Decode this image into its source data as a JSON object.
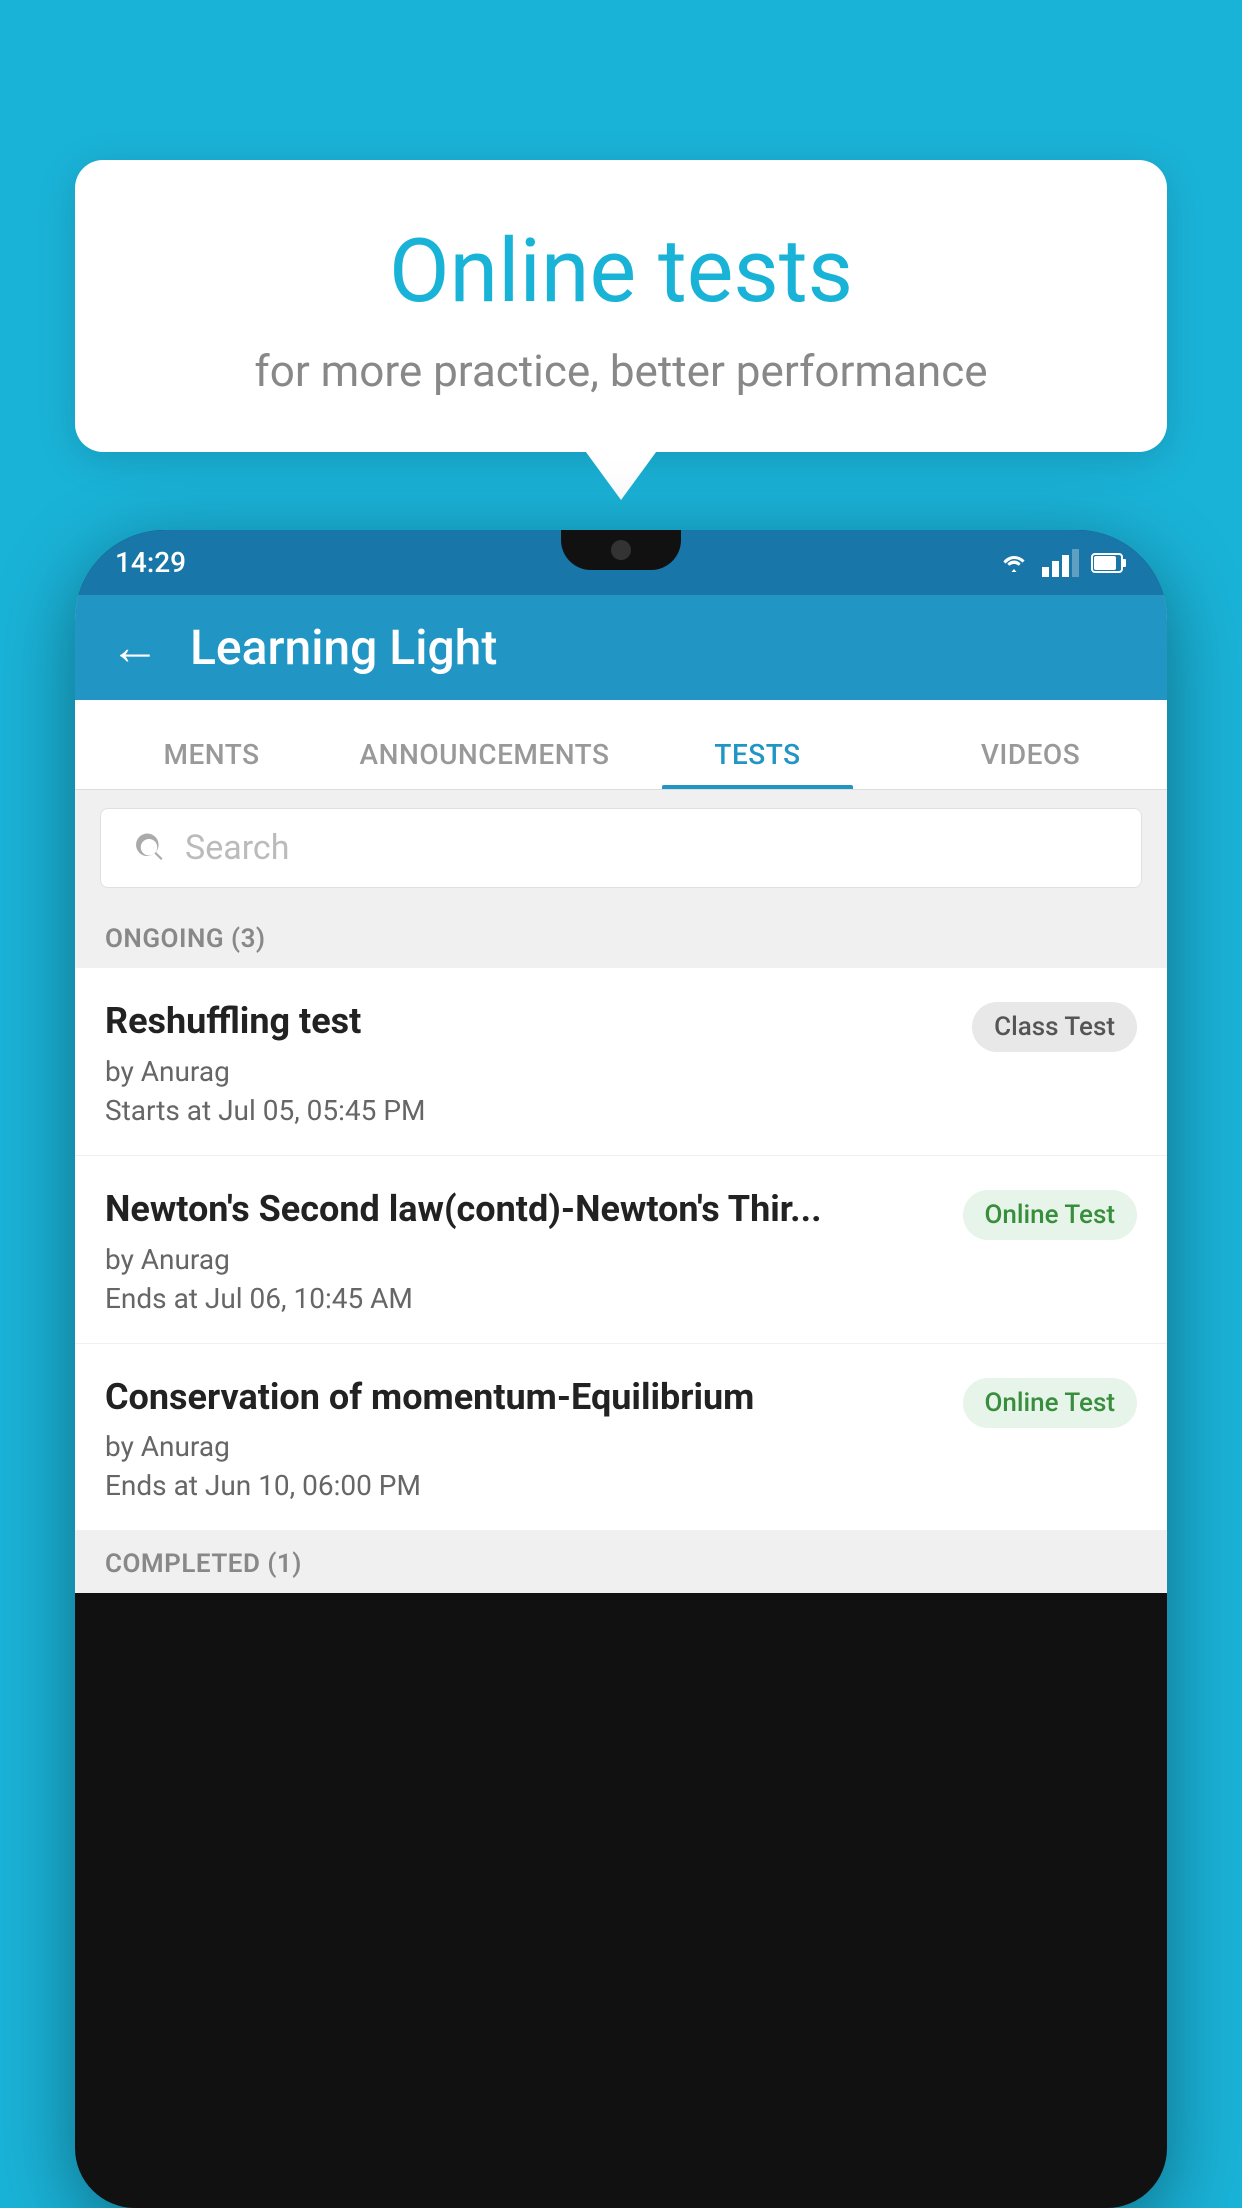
{
  "background": {
    "color": "#1ab3d8"
  },
  "hero": {
    "title": "Online tests",
    "subtitle": "for more practice, better performance"
  },
  "phone": {
    "statusBar": {
      "time": "14:29"
    },
    "appBar": {
      "title": "Learning Light",
      "backLabel": "←"
    },
    "tabs": [
      {
        "label": "MENTS",
        "active": false
      },
      {
        "label": "ANNOUNCEMENTS",
        "active": false
      },
      {
        "label": "TESTS",
        "active": true
      },
      {
        "label": "VIDEOS",
        "active": false
      }
    ],
    "search": {
      "placeholder": "Search"
    },
    "ongoingSection": {
      "label": "ONGOING (3)"
    },
    "tests": [
      {
        "title": "Reshuffling test",
        "author": "by Anurag",
        "time": "Starts at  Jul 05, 05:45 PM",
        "badge": "Class Test",
        "badgeType": "class"
      },
      {
        "title": "Newton's Second law(contd)-Newton's Thir...",
        "author": "by Anurag",
        "time": "Ends at  Jul 06, 10:45 AM",
        "badge": "Online Test",
        "badgeType": "online"
      },
      {
        "title": "Conservation of momentum-Equilibrium",
        "author": "by Anurag",
        "time": "Ends at  Jun 10, 06:00 PM",
        "badge": "Online Test",
        "badgeType": "online"
      }
    ],
    "completedSection": {
      "label": "COMPLETED (1)"
    }
  }
}
